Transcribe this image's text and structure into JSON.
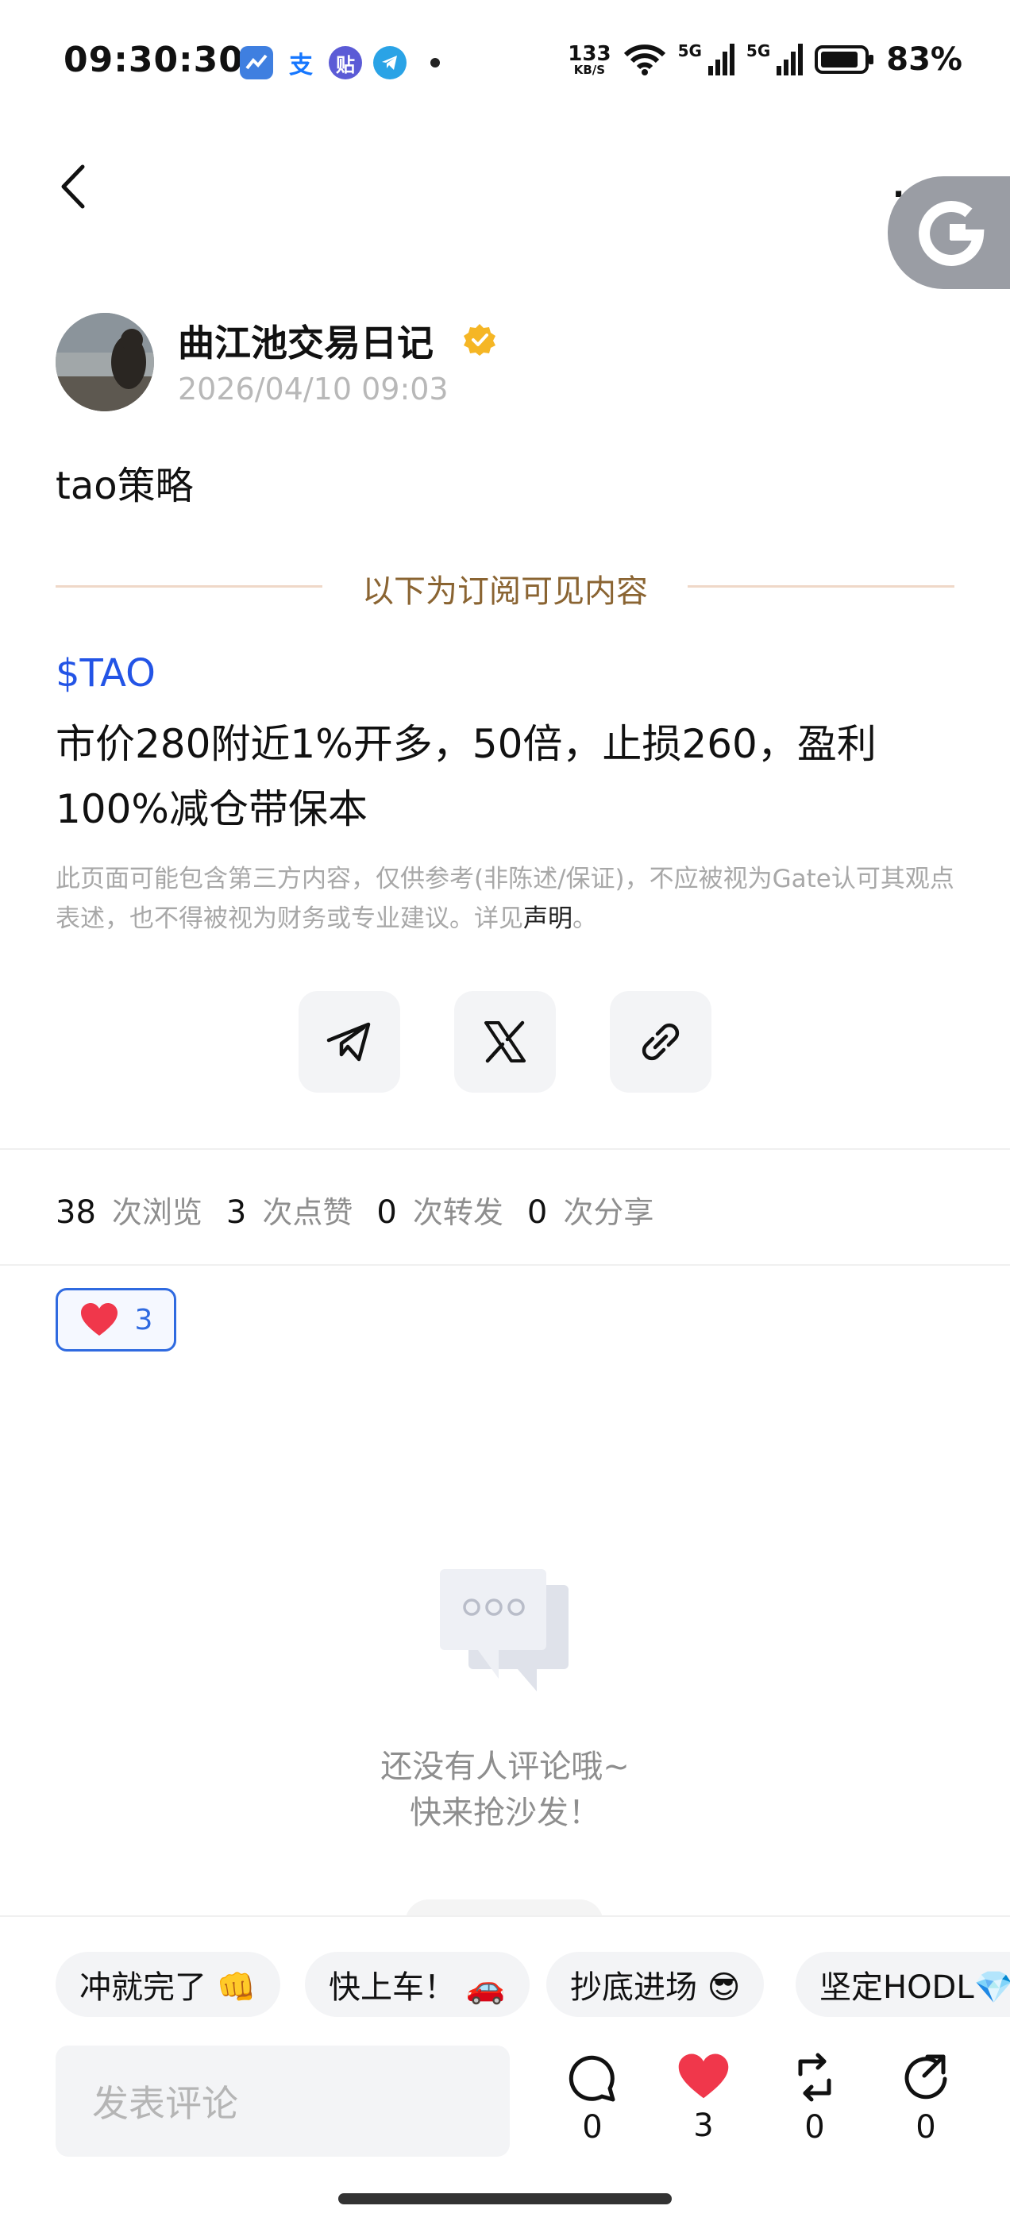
{
  "status_bar": {
    "time": "09:30:30",
    "apps": [
      {
        "name": "maps-app-icon",
        "glyph": "",
        "color": "#3f7fe0"
      },
      {
        "name": "alipay-app-icon",
        "glyph": "支",
        "color": "#1677ff"
      },
      {
        "name": "tieba-app-icon",
        "glyph": "贴",
        "color": "#5b5bd6"
      },
      {
        "name": "telegram-app-icon",
        "glyph": "",
        "color": "#2aa3e6"
      }
    ],
    "net_speed_value": "133",
    "net_speed_unit": "KB/S",
    "signal_1_label": "5G",
    "signal_2_label": "5G",
    "battery_percent": "83%"
  },
  "header": {
    "more_label": "···"
  },
  "author": {
    "name": "曲江池交易日记",
    "date": "2026/04/10 09:03"
  },
  "post": {
    "title": "tao策略",
    "subscription_divider": "以下为订阅可见内容",
    "ticker": "$TAO",
    "body": "市价280附近1%开多，50倍，止损260，盈利100%减仓带保本",
    "disclaimer": "此页面可能包含第三方内容，仅供参考(非陈述/保证)，不应被视为Gate认可其观点表述，也不得被视为财务或专业建议。详见",
    "disclaimer_link": "声明",
    "disclaimer_end": "。"
  },
  "share_icons": [
    "telegram-icon",
    "x-icon",
    "link-icon"
  ],
  "stats": {
    "views": "38",
    "views_label": "次浏览",
    "likes": "3",
    "likes_label": "次点赞",
    "reposts": "0",
    "reposts_label": "次转发",
    "shares": "0",
    "shares_label": "次分享"
  },
  "reaction": {
    "count": "3"
  },
  "empty_comments": {
    "line1": "还没有人评论哦~",
    "line2": "快来抢沙发！"
  },
  "quick_replies": [
    "冲就完了 👊",
    "快上车！ 🚗",
    "抄底进场 😎",
    "坚定HODL💎"
  ],
  "comment_input": {
    "placeholder": "发表评论"
  },
  "actions": {
    "comment_count": "0",
    "like_count": "3",
    "repost_count": "0",
    "share_count": "0"
  },
  "colors": {
    "accent_blue": "#2f6ae0",
    "ticker_blue": "#2354e6",
    "heart_red": "#f0374b",
    "divider_gold": "#8a6432"
  }
}
